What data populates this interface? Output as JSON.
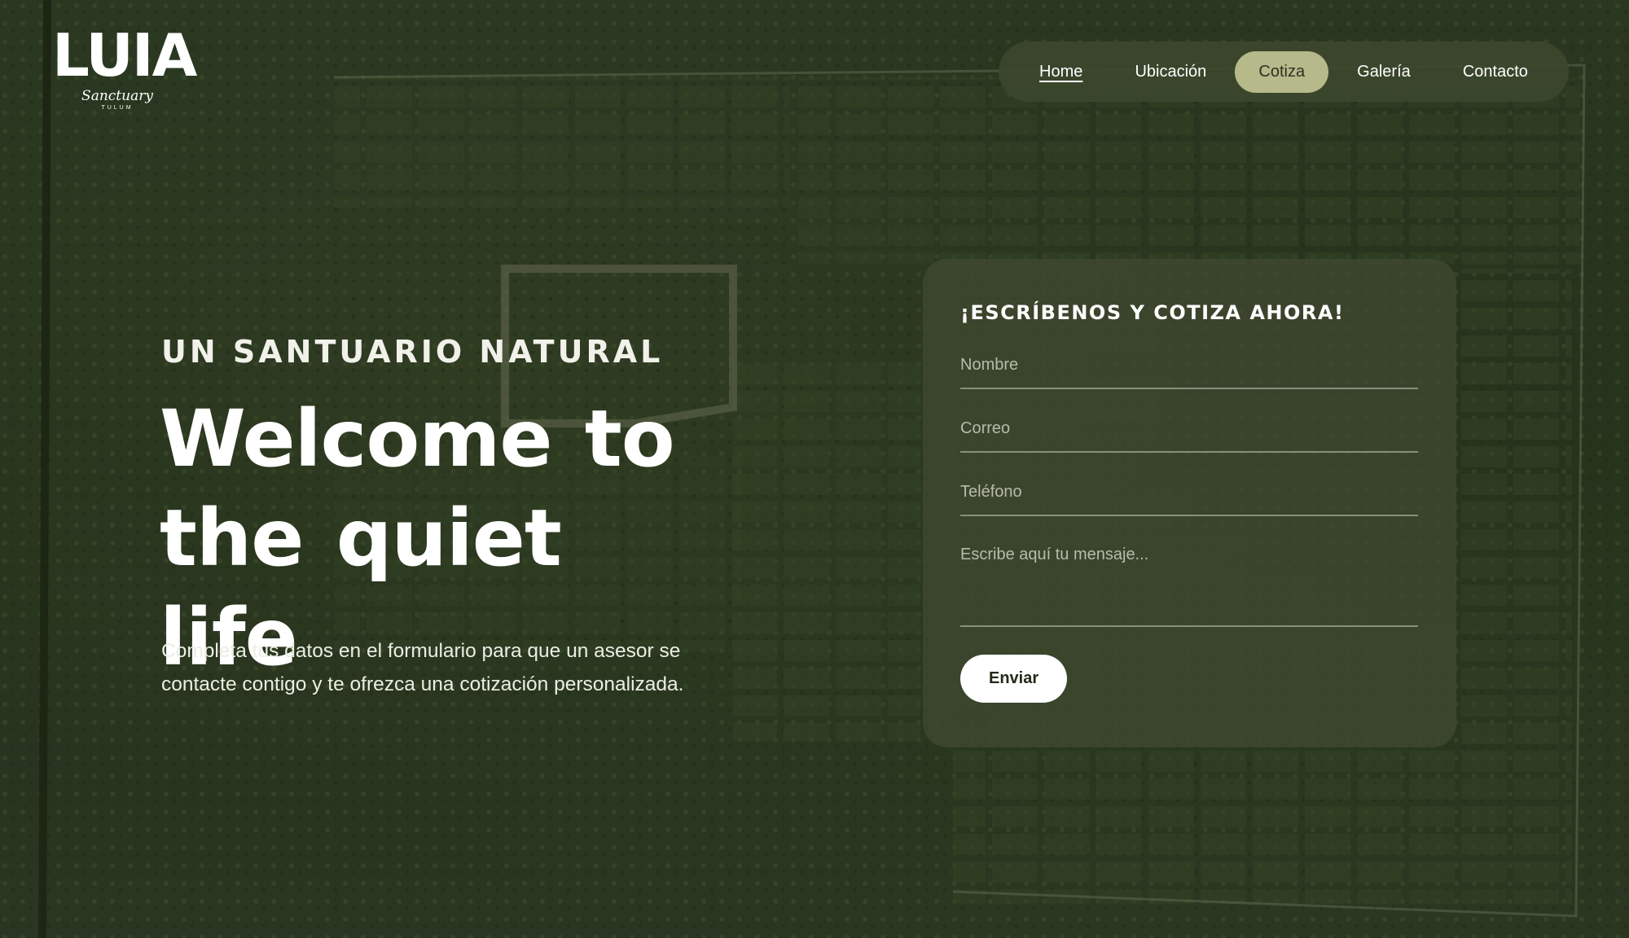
{
  "brand": {
    "logo_text": "LUIA",
    "logo_sub": "Sanctuary",
    "logo_tiny": "TULUM"
  },
  "nav": {
    "items": [
      {
        "label": "Home"
      },
      {
        "label": "Ubicación"
      },
      {
        "label": "Cotiza"
      },
      {
        "label": "Galería"
      },
      {
        "label": "Contacto"
      }
    ],
    "current": "Home",
    "active": "Cotiza"
  },
  "hero": {
    "eyebrow": "UN SANTUARIO NATURAL",
    "headline_line1": "Welcome to",
    "headline_line2": "the quiet life",
    "lead": "Completa tus datos en el formulario para que un asesor se contacte contigo y te ofrezca una cotización personalizada."
  },
  "form": {
    "title": "¡ESCRÍBENOS Y COTIZA AHORA!",
    "name_placeholder": "Nombre",
    "email_placeholder": "Correo",
    "phone_placeholder": "Teléfono",
    "message_placeholder": "Escribe aquí tu mensaje...",
    "submit_label": "Enviar"
  },
  "colors": {
    "nav_active": "#b6b98a",
    "card_bg": "#3e4830",
    "text": "#ffffff"
  }
}
